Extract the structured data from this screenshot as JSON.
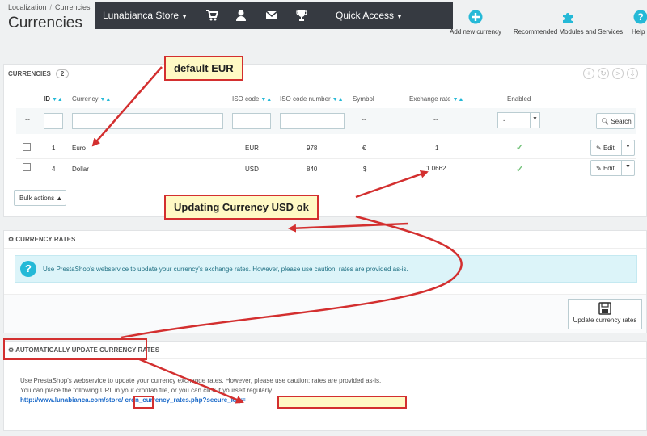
{
  "breadcrumb": {
    "item1": "Localization",
    "item2": "Currencies"
  },
  "page_title": "Currencies",
  "topbar": {
    "store": "Lunabianca Store",
    "quick_access": "Quick Access"
  },
  "toolbar": {
    "add_currency": "Add new currency",
    "recommended": "Recommended Modules and Services",
    "help": "Help"
  },
  "currencies_panel": {
    "title": "CURRENCIES",
    "count": "2",
    "columns": [
      "ID",
      "Currency",
      "ISO code",
      "ISO code number",
      "Symbol",
      "Exchange rate",
      "Enabled"
    ],
    "filter_dash": "--",
    "filter_select": "-",
    "search_label": "Search",
    "rows": [
      {
        "id": "1",
        "currency": "Euro",
        "iso": "EUR",
        "iso_num": "978",
        "symbol": "€",
        "rate": "1",
        "edit": "Edit"
      },
      {
        "id": "4",
        "currency": "Dollar",
        "iso": "USD",
        "iso_num": "840",
        "symbol": "$",
        "rate": "1.0662",
        "edit": "Edit"
      }
    ],
    "bulk_actions": "Bulk actions"
  },
  "rates_panel": {
    "title": "CURRENCY RATES",
    "info": "Use PrestaShop's webservice to update your currency's exchange rates. However, please use caution: rates are provided as-is.",
    "update_button": "Update currency rates"
  },
  "auto_panel": {
    "title": "AUTOMATICALLY UPDATE CURRENCY RATES",
    "line1": "Use PrestaShop's webservice to update your currency exchange rates. However, please use caution: rates are provided as-is.",
    "line2": "You can place the following URL in your crontab file, or you can click it yourself regularly",
    "link": "http://www.lunabianca.com/store/        cron_currency_rates.php?secure_key="
  },
  "annotations": {
    "default_eur": "default EUR",
    "updating_usd": "Updating Currency USD ok"
  },
  "colors": {
    "accent": "#25b9d7",
    "annotation_red": "#d32f2f",
    "topbar": "#363a41",
    "enabled_check": "#72c279"
  }
}
